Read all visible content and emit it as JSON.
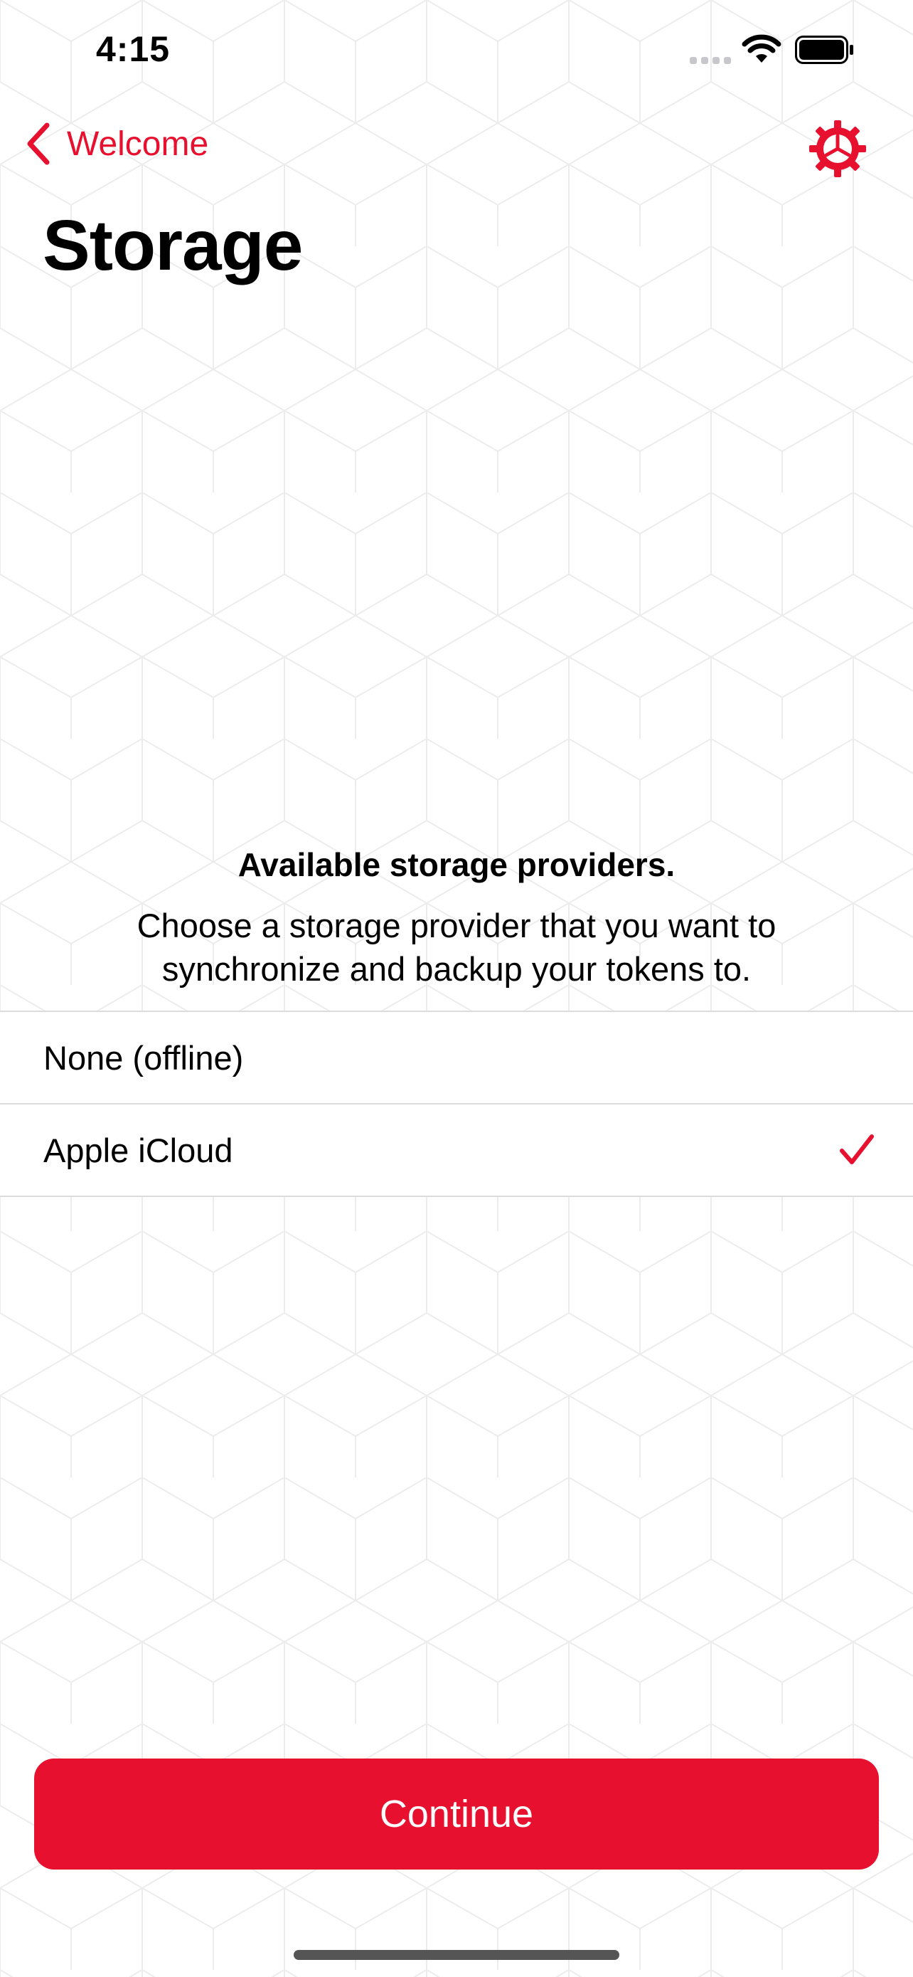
{
  "status_bar": {
    "time": "4:15"
  },
  "nav": {
    "back_label": "Welcome"
  },
  "page": {
    "title": "Storage"
  },
  "providers": {
    "heading": "Available storage providers.",
    "description": "Choose a storage provider that you want to synchronize and backup your tokens to.",
    "options": [
      {
        "label": "None (offline)",
        "selected": false
      },
      {
        "label": "Apple iCloud",
        "selected": true
      }
    ]
  },
  "actions": {
    "continue_label": "Continue"
  },
  "colors": {
    "accent": "#e8102f",
    "separator": "#dcdcde",
    "pattern": "#ececec"
  },
  "icons": [
    "chevron-left-icon",
    "gear-icon",
    "checkmark-icon",
    "wifi-icon",
    "battery-icon",
    "cellular-signal-icon"
  ]
}
